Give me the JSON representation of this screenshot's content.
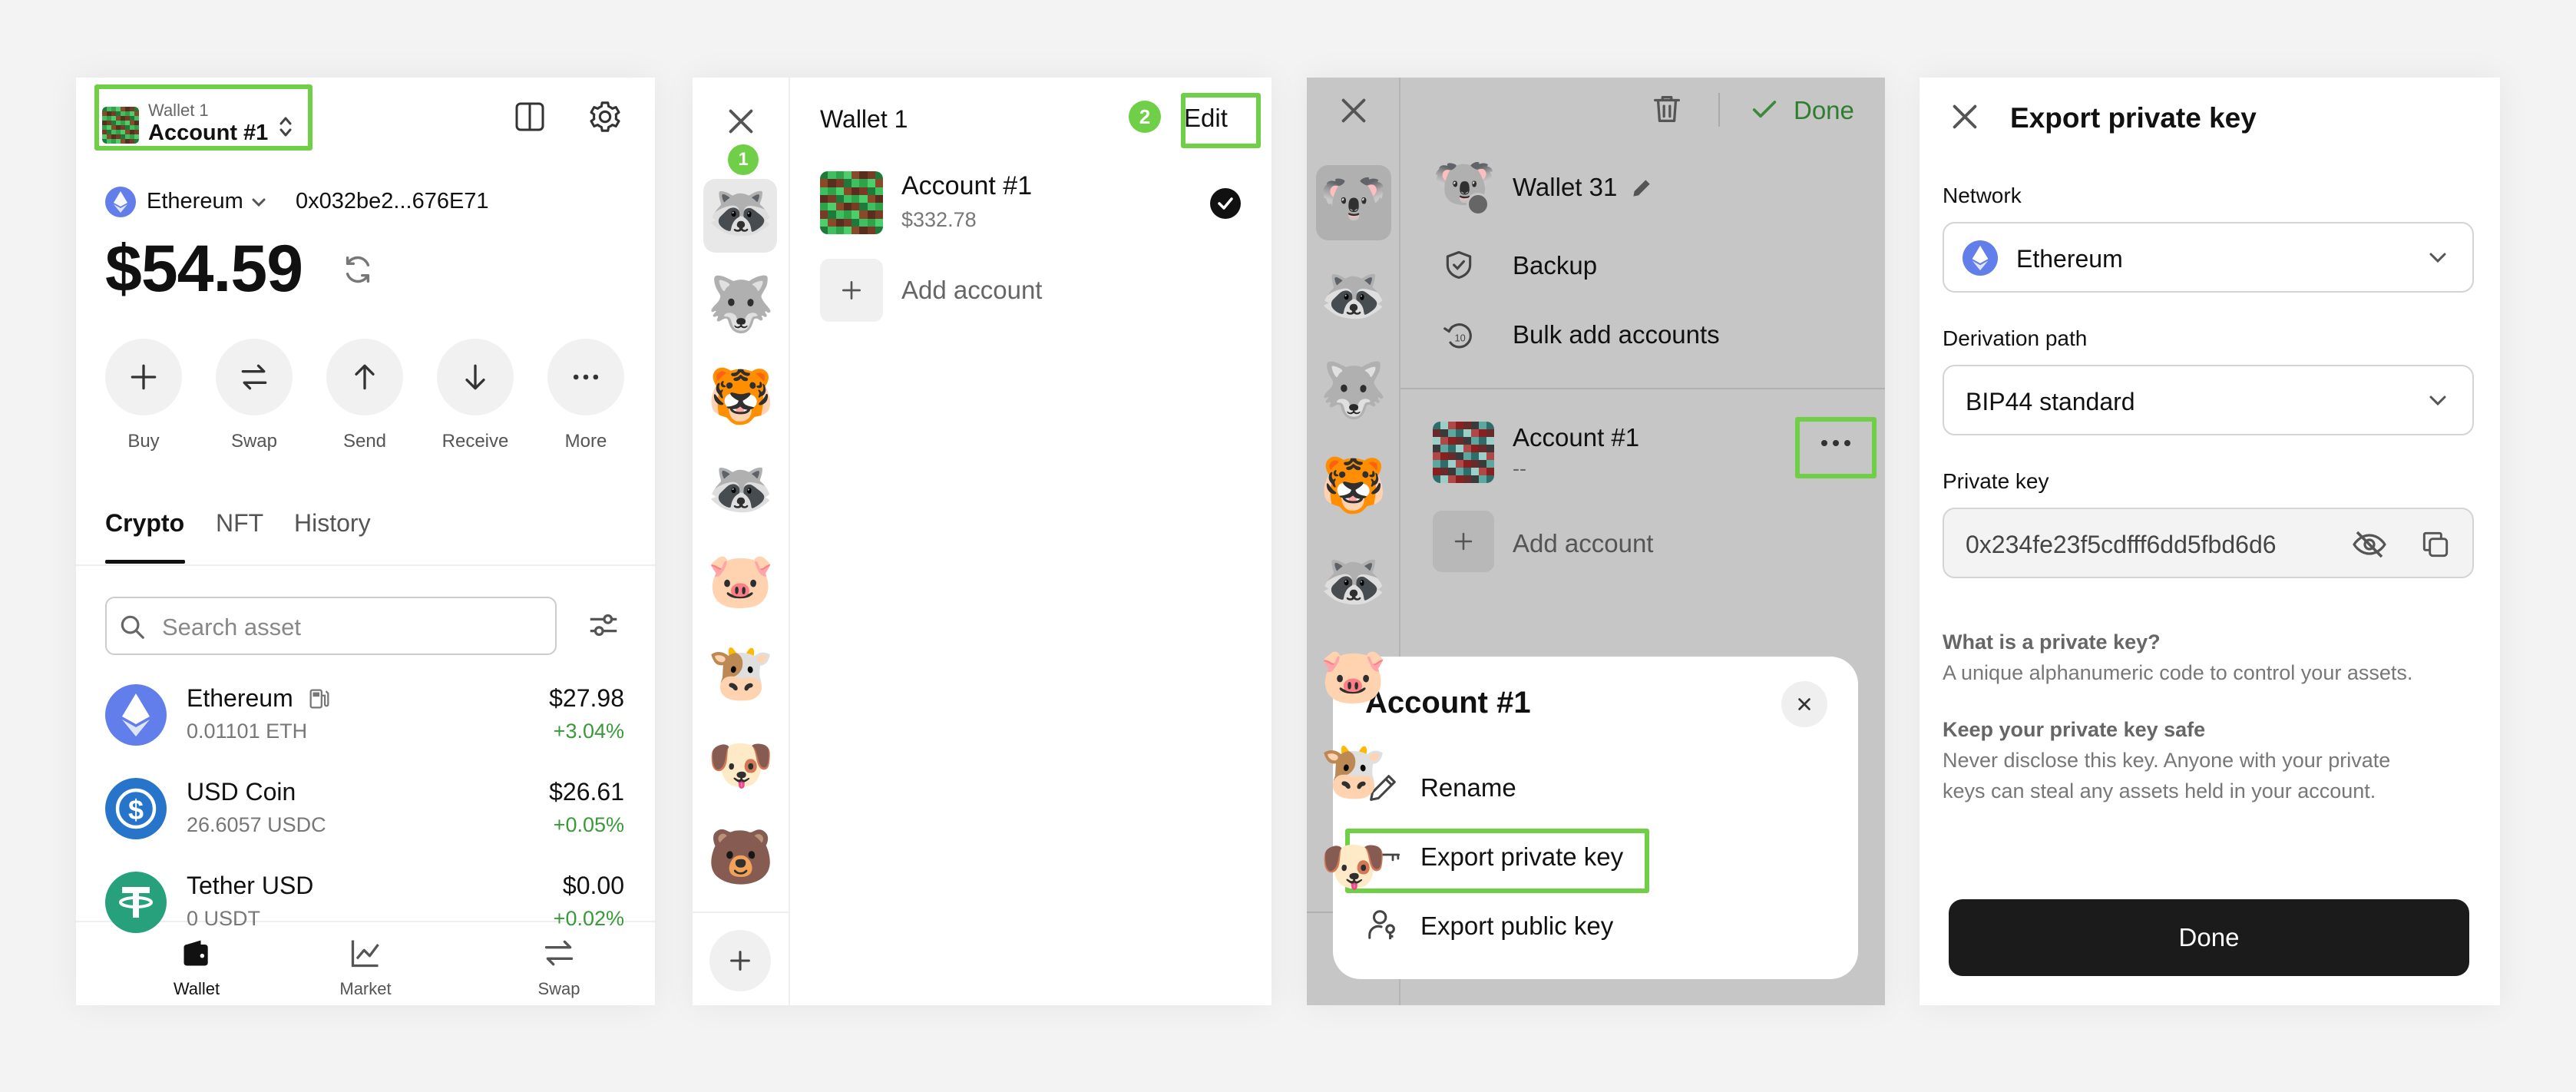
{
  "colors": {
    "highlight": "#6fcf47",
    "green": "#3a9a3a",
    "ethereum": "#627eea",
    "usdc": "#2775ca",
    "tether": "#26a17b",
    "dark": "#1b1b1b"
  },
  "panel1": {
    "wallet_name": "Wallet 1",
    "account_name": "Account #1",
    "network": "Ethereum",
    "address": "0x032be2...676E71",
    "balance": "$54.59",
    "actions": [
      {
        "label": "Buy",
        "icon": "plus-icon"
      },
      {
        "label": "Swap",
        "icon": "swap-icon"
      },
      {
        "label": "Send",
        "icon": "arrow-up-icon"
      },
      {
        "label": "Receive",
        "icon": "arrow-down-icon"
      },
      {
        "label": "More",
        "icon": "more-icon"
      }
    ],
    "tabs": [
      "Crypto",
      "NFT",
      "History"
    ],
    "search_placeholder": "Search asset",
    "assets": [
      {
        "name": "Ethereum",
        "amount": "0.01101 ETH",
        "value": "$27.98",
        "change": "+3.04%",
        "icon": "ethereum-icon"
      },
      {
        "name": "USD Coin",
        "amount": "26.6057 USDC",
        "value": "$26.61",
        "change": "+0.05%",
        "icon": "usdc-icon"
      },
      {
        "name": "Tether USD",
        "amount": "0 USDT",
        "value": "$0.00",
        "change": "+0.02%",
        "icon": "tether-icon"
      }
    ],
    "nav": [
      {
        "label": "Wallet",
        "icon": "wallet-icon"
      },
      {
        "label": "Market",
        "icon": "chart-icon"
      },
      {
        "label": "Swap",
        "icon": "swap-icon"
      }
    ]
  },
  "panel2": {
    "step1": "1",
    "step2": "2",
    "wallet_title": "Wallet 1",
    "edit_label": "Edit",
    "account_name": "Account #1",
    "account_balance": "$332.78",
    "add_account": "Add account",
    "avatars": [
      "🦝",
      "🐺",
      "🐯",
      "🦝",
      "🐷",
      "🐮",
      "🐶",
      "🐻"
    ]
  },
  "panel3": {
    "done_label": "Done",
    "wallet_name": "Wallet 31",
    "menu": [
      {
        "label": "Backup",
        "icon": "shield-check-icon"
      },
      {
        "label": "Bulk add accounts",
        "icon": "bulk-add-icon"
      }
    ],
    "account_name": "Account #1",
    "account_balance": "--",
    "add_account": "Add account",
    "avatars": [
      "🐨",
      "🦝",
      "🐺",
      "🐯",
      "🦝",
      "🐷",
      "🐮",
      "🐶"
    ],
    "sheet": {
      "title": "Account #1",
      "items": [
        {
          "label": "Rename",
          "icon": "pencil-icon"
        },
        {
          "label": "Export private key",
          "icon": "key-icon"
        },
        {
          "label": "Export public key",
          "icon": "user-key-icon"
        }
      ]
    }
  },
  "panel4": {
    "title": "Export private key",
    "network_label": "Network",
    "network_value": "Ethereum",
    "derivation_label": "Derivation path",
    "derivation_value": "BIP44 standard",
    "private_key_label": "Private key",
    "private_key_value": "0x234fe23f5cdfff6dd5fbd6d6",
    "what_title": "What is a private key?",
    "what_body": "A unique alphanumeric code to control your assets.",
    "safe_title": "Keep your private key safe",
    "safe_body_1": "Never disclose this key. Anyone with your private",
    "safe_body_2": "keys can steal any assets held in your account.",
    "done_label": "Done"
  }
}
